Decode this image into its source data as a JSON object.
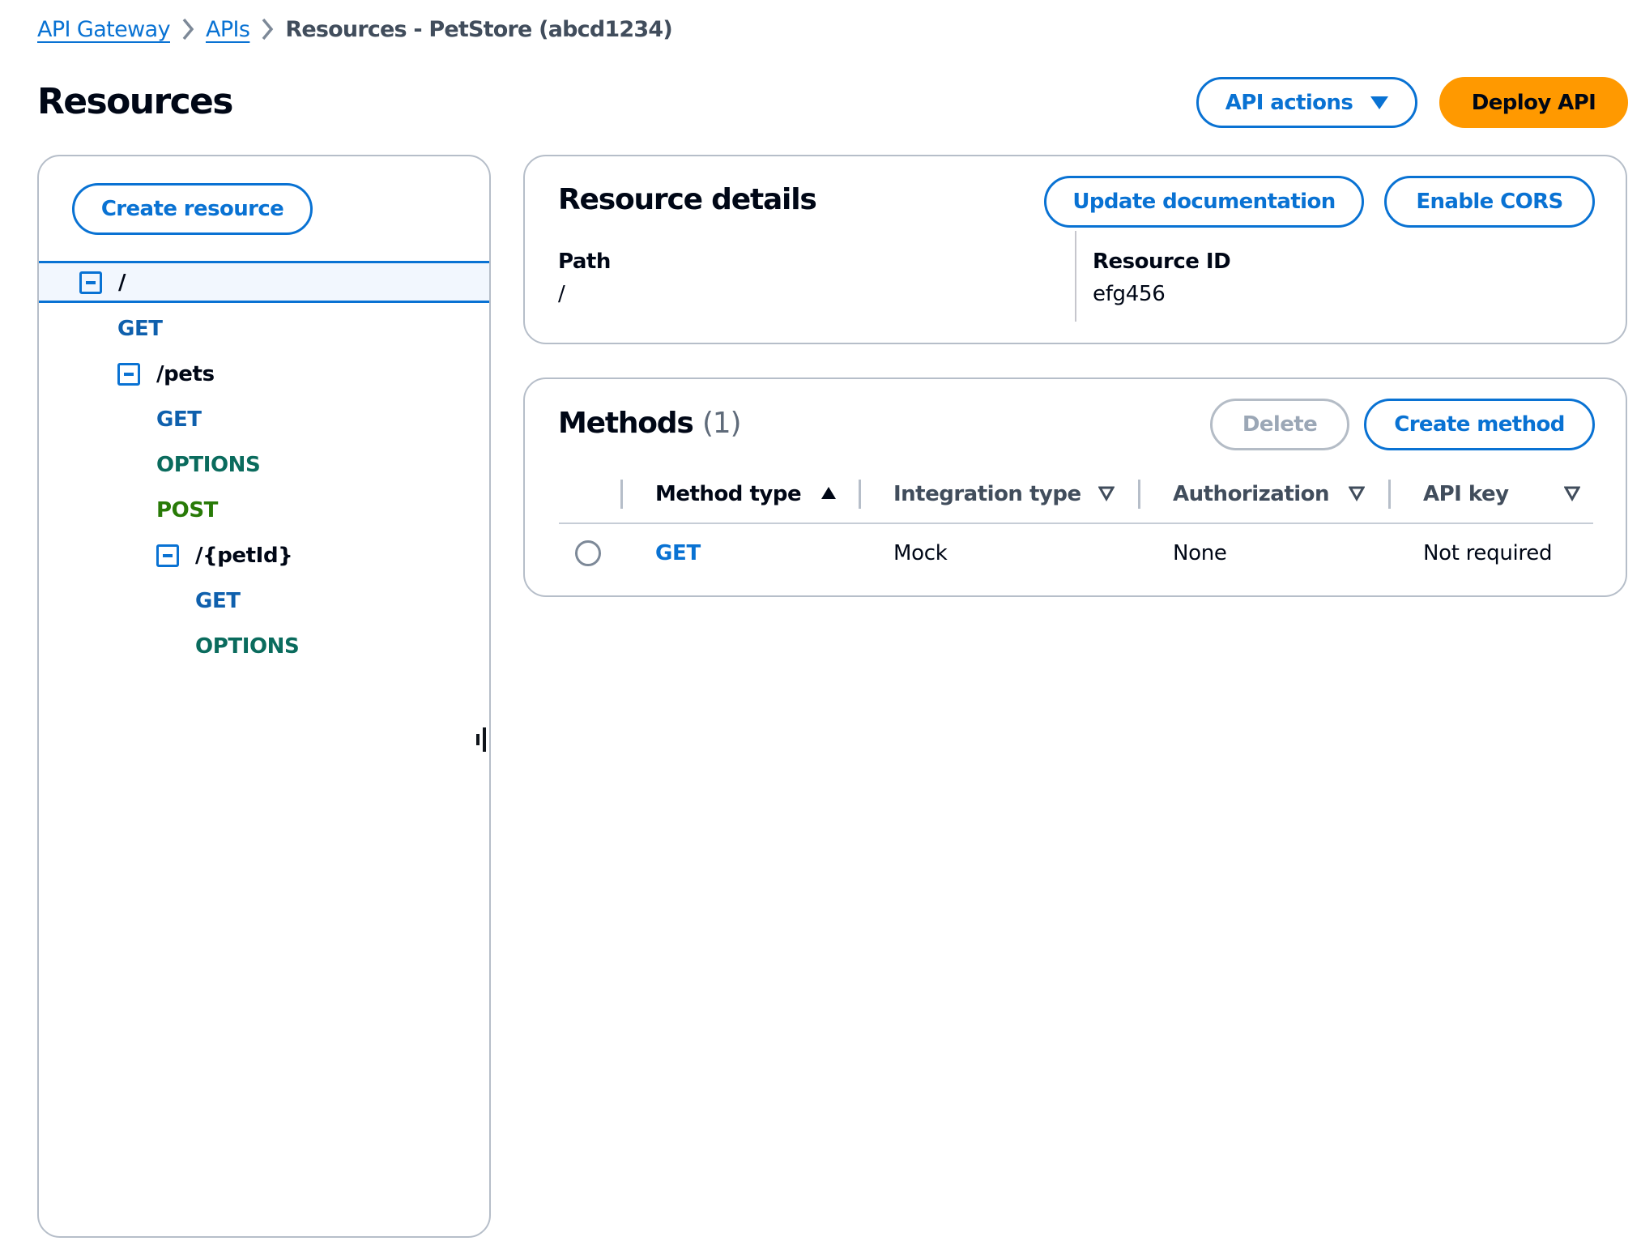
{
  "breadcrumb": {
    "items": [
      {
        "label": "API Gateway"
      },
      {
        "label": "APIs"
      }
    ],
    "current": "Resources - PetStore (abcd1234)"
  },
  "page": {
    "title": "Resources",
    "api_actions_label": "API actions",
    "deploy_label": "Deploy API"
  },
  "tree": {
    "create_resource_label": "Create resource",
    "nodes": [
      {
        "type": "resource",
        "label": "/",
        "level": 0,
        "selected": true
      },
      {
        "type": "method",
        "label": "GET",
        "level": 1
      },
      {
        "type": "resource",
        "label": "/pets",
        "level": 1
      },
      {
        "type": "method",
        "label": "GET",
        "level": 2
      },
      {
        "type": "method",
        "label": "OPTIONS",
        "level": 2
      },
      {
        "type": "method",
        "label": "POST",
        "level": 2
      },
      {
        "type": "resource",
        "label": "/{petId}",
        "level": 2
      },
      {
        "type": "method",
        "label": "GET",
        "level": 3
      },
      {
        "type": "method",
        "label": "OPTIONS",
        "level": 3
      }
    ]
  },
  "details": {
    "title": "Resource details",
    "update_doc_label": "Update documentation",
    "enable_cors_label": "Enable CORS",
    "path_label": "Path",
    "path_value": "/",
    "resource_id_label": "Resource ID",
    "resource_id_value": "efg456"
  },
  "methods": {
    "title": "Methods",
    "count": "(1)",
    "delete_label": "Delete",
    "create_label": "Create method",
    "columns": [
      {
        "label": "Method type",
        "sort": "ascending"
      },
      {
        "label": "Integration type",
        "sort": "none"
      },
      {
        "label": "Authorization",
        "sort": "none"
      },
      {
        "label": "API key",
        "sort": "none"
      }
    ],
    "rows": [
      {
        "method": "GET",
        "integration": "Mock",
        "authorization": "None",
        "api_key": "Not required",
        "selected": false
      }
    ]
  },
  "colors": {
    "accent": "#0972d3",
    "primary_button": "#ff9900",
    "method_get": "#0f60ad",
    "method_options": "#0a6b5d",
    "method_post": "#287a07"
  }
}
